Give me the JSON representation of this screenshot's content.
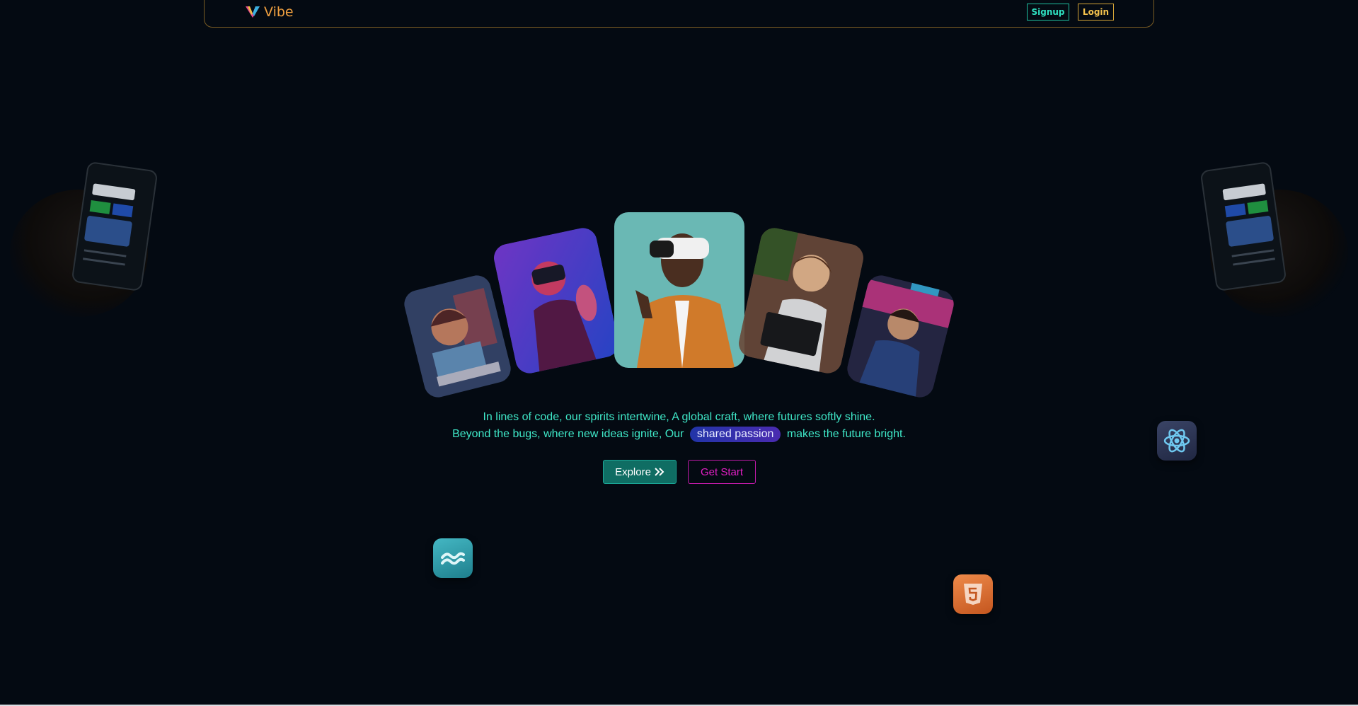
{
  "nav": {
    "brand": "Vibe",
    "signup_label": "Signup",
    "login_label": "Login"
  },
  "hero": {
    "line1": "In lines of code, our spirits intertwine, A global craft, where futures softly shine.",
    "line2_before": "Beyond the bugs, where new ideas ignite, Our",
    "line2_highlight": "shared passion",
    "line2_after": "makes the future bright.",
    "explore_label": "Explore",
    "getstart_label": "Get Start"
  },
  "colors": {
    "background": "#040a12",
    "accent_teal": "#3fe8c8",
    "accent_gold": "#f3c24d",
    "accent_magenta": "#e21fc4",
    "brand_orange": "#f0a040"
  },
  "icons": {
    "brand": "vibe-logo-icon",
    "explore": "double-chevron-right-icon",
    "tech": [
      "tailwind-icon",
      "react-icon",
      "html5-icon"
    ]
  }
}
